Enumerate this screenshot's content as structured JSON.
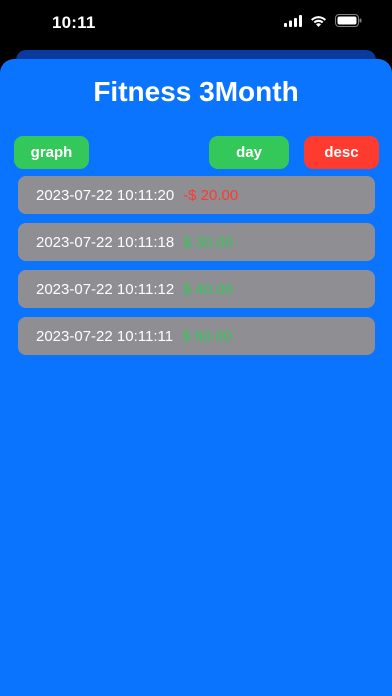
{
  "status_bar": {
    "time": "10:11",
    "icons": [
      "signal-icon",
      "wifi-icon",
      "battery-icon"
    ]
  },
  "header": {
    "title": "Fitness 3Month"
  },
  "toolbar": {
    "graph_label": "graph",
    "day_label": "day",
    "desc_label": "desc"
  },
  "colors": {
    "background": "#0a74ff",
    "row": "#8e8e93",
    "positive": "#34c759",
    "negative": "#ff3b30"
  },
  "entries": [
    {
      "timestamp": "2023-07-22 10:11:20",
      "amount": "-$ 20.00",
      "sign": "negative"
    },
    {
      "timestamp": "2023-07-22 10:11:18",
      "amount": "$ 30.00",
      "sign": "positive"
    },
    {
      "timestamp": "2023-07-22 10:11:12",
      "amount": "$ 40.00",
      "sign": "positive"
    },
    {
      "timestamp": "2023-07-22 10:11:11",
      "amount": "$ 60.00",
      "sign": "positive"
    }
  ]
}
